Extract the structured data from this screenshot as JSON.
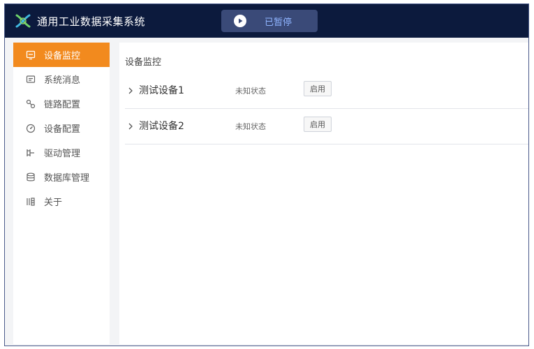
{
  "header": {
    "title": "通用工业数据采集系统",
    "pause_label": "已暂停"
  },
  "colors": {
    "header_bg": "#0c1a3d",
    "accent_active": "#f28a1e",
    "pill_bg": "#3a4a78",
    "pill_text": "#8fb4ff"
  },
  "sidebar": {
    "items": [
      {
        "label": "设备监控",
        "icon": "monitor-icon",
        "active": true
      },
      {
        "label": "系统消息",
        "icon": "message-icon",
        "active": false
      },
      {
        "label": "链路配置",
        "icon": "link-icon",
        "active": false
      },
      {
        "label": "设备配置",
        "icon": "gauge-icon",
        "active": false
      },
      {
        "label": "驱动管理",
        "icon": "driver-icon",
        "active": false
      },
      {
        "label": "数据库管理",
        "icon": "database-icon",
        "active": false
      },
      {
        "label": "关于",
        "icon": "info-icon",
        "active": false
      }
    ]
  },
  "main": {
    "title": "设备监控",
    "devices": [
      {
        "name": "测试设备1",
        "status": "未知状态",
        "action": "启用"
      },
      {
        "name": "测试设备2",
        "status": "未知状态",
        "action": "启用"
      }
    ]
  }
}
